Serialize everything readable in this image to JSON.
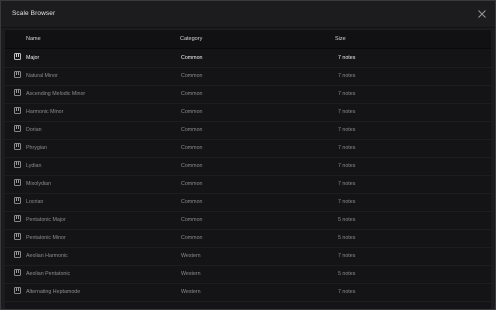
{
  "window": {
    "title": "Scale Browser"
  },
  "columns": {
    "name": "Name",
    "category": "Category",
    "size": "Size"
  },
  "rows": [
    {
      "name": "Major",
      "category": "Common",
      "size": "7 notes",
      "active": true
    },
    {
      "name": "Natural Minor",
      "category": "Common",
      "size": "7 notes"
    },
    {
      "name": "Ascending Melodic Minor",
      "category": "Common",
      "size": "7 notes"
    },
    {
      "name": "Harmonic Minor",
      "category": "Common",
      "size": "7 notes"
    },
    {
      "name": "Dorian",
      "category": "Common",
      "size": "7 notes"
    },
    {
      "name": "Phrygian",
      "category": "Common",
      "size": "7 notes"
    },
    {
      "name": "Lydian",
      "category": "Common",
      "size": "7 notes"
    },
    {
      "name": "Mixolydian",
      "category": "Common",
      "size": "7 notes"
    },
    {
      "name": "Locrian",
      "category": "Common",
      "size": "7 notes"
    },
    {
      "name": "Pentatonic Major",
      "category": "Common",
      "size": "5 notes"
    },
    {
      "name": "Pentatonic Minor",
      "category": "Common",
      "size": "5 notes"
    },
    {
      "name": "Aeolian Harmonic",
      "category": "Western",
      "size": "7 notes"
    },
    {
      "name": "Aeolian Pentatonic",
      "category": "Western",
      "size": "5 notes"
    },
    {
      "name": "Alternating Heptamode",
      "category": "Western",
      "size": "7 notes"
    }
  ],
  "icons": {
    "close": "close-icon",
    "row": "piano-keys-icon"
  }
}
